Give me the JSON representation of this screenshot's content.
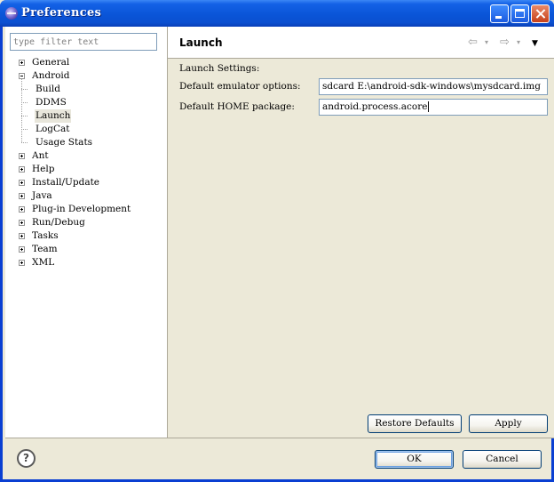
{
  "window": {
    "title": "Preferences"
  },
  "filter": {
    "placeholder": "type filter text"
  },
  "tree": [
    {
      "label": "General",
      "expander": "plus",
      "level": 0
    },
    {
      "label": "Android",
      "expander": "minus",
      "level": 0
    },
    {
      "label": "Build",
      "level": 1
    },
    {
      "label": "DDMS",
      "level": 1
    },
    {
      "label": "Launch",
      "level": 1,
      "selected": true
    },
    {
      "label": "LogCat",
      "level": 1
    },
    {
      "label": "Usage Stats",
      "level": 1
    },
    {
      "label": "Ant",
      "expander": "plus",
      "level": 0
    },
    {
      "label": "Help",
      "expander": "plus",
      "level": 0
    },
    {
      "label": "Install/Update",
      "expander": "plus",
      "level": 0
    },
    {
      "label": "Java",
      "expander": "plus",
      "level": 0
    },
    {
      "label": "Plug-in Development",
      "expander": "plus",
      "level": 0
    },
    {
      "label": "Run/Debug",
      "expander": "plus",
      "level": 0
    },
    {
      "label": "Tasks",
      "expander": "plus",
      "level": 0
    },
    {
      "label": "Team",
      "expander": "plus",
      "level": 0
    },
    {
      "label": "XML",
      "expander": "plus",
      "level": 0
    }
  ],
  "page": {
    "title": "Launch",
    "section_label": "Launch Settings:",
    "emulator_options_label": "Default emulator options:",
    "emulator_options_value": "sdcard E:\\android-sdk-windows\\mysdcard.img",
    "home_package_label": "Default HOME package:",
    "home_package_value": "android.process.acore"
  },
  "buttons": {
    "restore_defaults": "Restore Defaults",
    "apply": "Apply",
    "ok": "OK",
    "cancel": "Cancel",
    "help": "?"
  },
  "icons": {
    "app": "eclipse-icon",
    "back": "back-arrow-icon",
    "forward": "forward-arrow-icon",
    "menu": "view-menu-icon",
    "help": "help-icon"
  }
}
